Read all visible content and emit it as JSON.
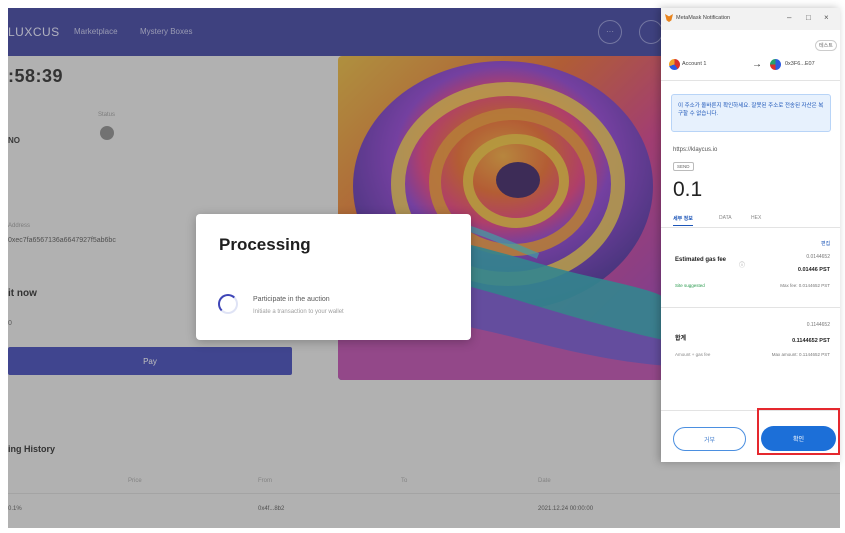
{
  "app": {
    "brand": "LUXCUS",
    "nav_links": [
      "Marketplace",
      "Mystery Boxes"
    ],
    "timer": ":58:39",
    "info_label": "Status",
    "info_value": "NO",
    "address_label": "Address",
    "address": "0xec7fa6567136a6647927f5ab6bc",
    "join_heading": "it now",
    "small_value": "0",
    "pay_label": "Pay",
    "history_heading": "ing History",
    "history_columns": [
      "Price",
      "From",
      "To",
      "Date"
    ],
    "history_row": [
      "0.1%",
      "0x4f...8b2",
      "",
      "2021.12.24 00:00:00"
    ],
    "colors": {
      "nav": "#3b3f9e",
      "pay_button": "#3e45b7"
    }
  },
  "modal": {
    "title": "Processing",
    "step": "Participate in the auction",
    "step_sub": "Initiate a transaction to your wallet"
  },
  "metamask": {
    "window_title": "MetaMask Notification",
    "network": "테스트",
    "from_account": "Account 1",
    "to_account": "0x3F6...E07",
    "notice": "이 주소가 올바른지 확인하세요. 잘못된 주소로 전송된 자산은 복구할 수 없습니다.",
    "origin": "https://klaycus.io",
    "badge": "SEND",
    "amount": "0.1",
    "tabs": [
      "세부 정보",
      "DATA",
      "HEX"
    ],
    "edit_label": "편집",
    "gas_label": "Estimated gas fee",
    "gas_approx": "0.0144652",
    "gas_main": "0.01446 PST",
    "gas_likely": "Site suggested",
    "gas_max": "Max fee: 0.0144652 PST",
    "total_label": "합계",
    "total_approx": "0.1144652",
    "total_main": "0.1144652 PST",
    "total_sub": "Amount + gas fee",
    "total_max": "Max amount: 0.1144652 PST",
    "reject_label": "거부",
    "confirm_label": "확인",
    "colors": {
      "confirm": "#1c6fd8",
      "highlight": "#e5282e"
    }
  }
}
